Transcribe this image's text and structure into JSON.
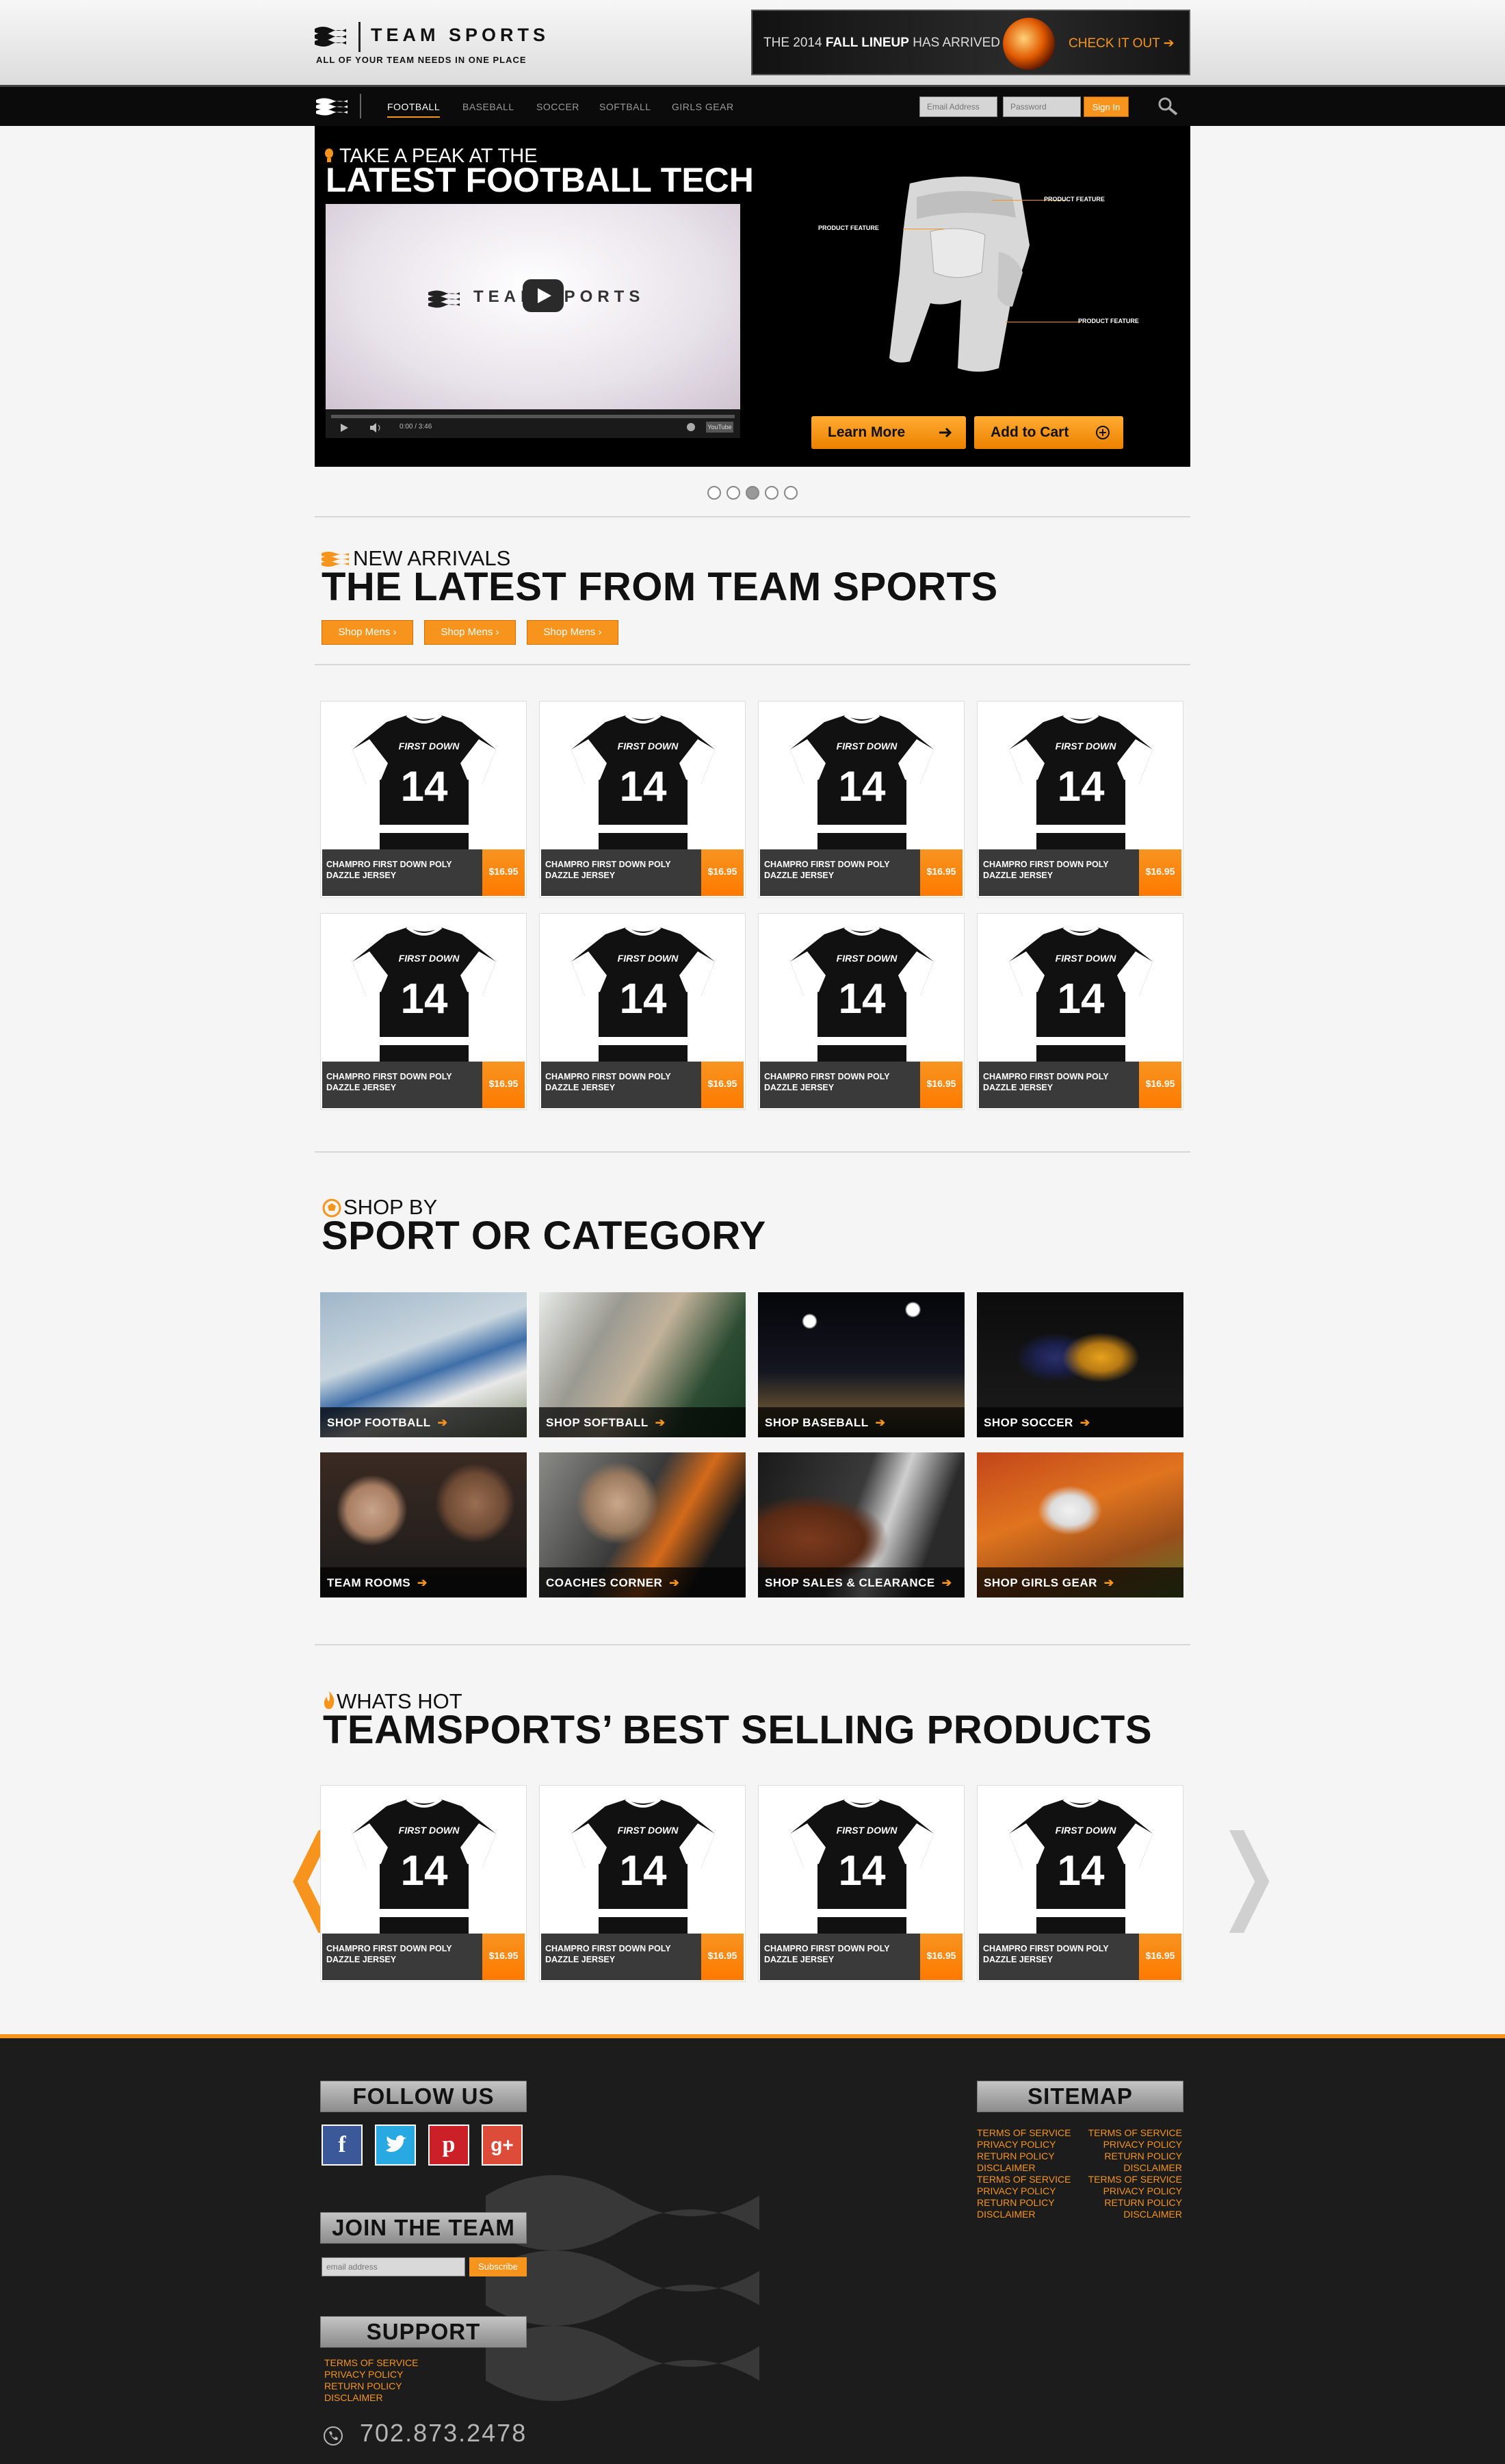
{
  "header": {
    "logo_text": "TEAM SPORTS",
    "tagline": "ALL OF YOUR TEAM NEEDS IN ONE PLACE",
    "promo": {
      "prefix": "THE 2014 ",
      "highlight": "FALL LINEUP",
      "suffix": " HAS ARRIVED",
      "cta": "CHECK IT OUT"
    }
  },
  "nav": {
    "items": [
      {
        "label": "FOOTBALL",
        "active": true
      },
      {
        "label": "BASEBALL"
      },
      {
        "label": "SOCCER"
      },
      {
        "label": "SOFTBALL"
      },
      {
        "label": "GIRLS GEAR"
      }
    ],
    "email_placeholder": "Email Address",
    "password_placeholder": "Password",
    "signin_label": "Sign In"
  },
  "hero": {
    "kicker": "TAKE A PEAK AT THE",
    "title": "LATEST FOOTBALL TECH",
    "video_brand": "TEAM SPORTS",
    "video_time": "0:00 / 3:46",
    "video_logo": "YouTube",
    "features": [
      "PRODUCT FEATURE",
      "PRODUCT FEATURE",
      "PRODUCT FEATURE"
    ],
    "learn_more": "Learn More",
    "add_to_cart": "Add to Cart",
    "slide_count": 5,
    "active_slide": 3
  },
  "new_arrivals": {
    "kicker": "NEW ARRIVALS",
    "title": "THE LATEST FROM TEAM SPORTS",
    "buttons": [
      "Shop Mens",
      "Shop Mens",
      "Shop Mens"
    ]
  },
  "products": {
    "name": "CHAMPRO FIRST DOWN POLY DAZZLE JERSEY",
    "price": "$16.95",
    "jersey_text": "FIRST DOWN",
    "jersey_number": "14"
  },
  "categories": {
    "kicker": "SHOP BY",
    "title": "SPORT OR CATEGORY",
    "tiles": [
      "SHOP FOOTBALL",
      "SHOP SOFTBALL",
      "SHOP BASEBALL",
      "SHOP SOCCER",
      "TEAM ROOMS",
      "COACHES CORNER",
      "SHOP SALES & CLEARANCE",
      "SHOP GIRLS GEAR"
    ]
  },
  "whats_hot": {
    "kicker": "WHATS HOT",
    "title": "TEAMSPORTS’ BEST SELLING PRODUCTS"
  },
  "footer": {
    "follow_us": "FOLLOW US",
    "social": [
      "f",
      "t",
      "p",
      "g+"
    ],
    "join_team": "JOIN THE TEAM",
    "email_placeholder": "email address",
    "subscribe": "Subscribe",
    "support": "SUPPORT",
    "support_links": [
      "TERMS OF SERVICE",
      "PRIVACY POLICY",
      "RETURN POLICY",
      "DISCLAIMER"
    ],
    "sitemap": "SITEMAP",
    "sitemap_left": [
      "TERMS OF SERVICE",
      "PRIVACY POLICY",
      "RETURN POLICY",
      "DISCLAIMER",
      "TERMS OF SERVICE",
      "PRIVACY POLICY",
      "RETURN POLICY",
      "DISCLAIMER"
    ],
    "sitemap_right": [
      "TERMS OF SERVICE",
      "PRIVACY POLICY",
      "RETURN POLICY",
      "DISCLAIMER",
      "TERMS OF SERVICE",
      "PRIVACY POLICY",
      "RETURN POLICY",
      "DISCLAIMER"
    ],
    "phone": "702.873.2478"
  },
  "colors": {
    "accent": "#f7941d",
    "dark": "#0b0b0b",
    "footer": "#1c1c1c"
  }
}
